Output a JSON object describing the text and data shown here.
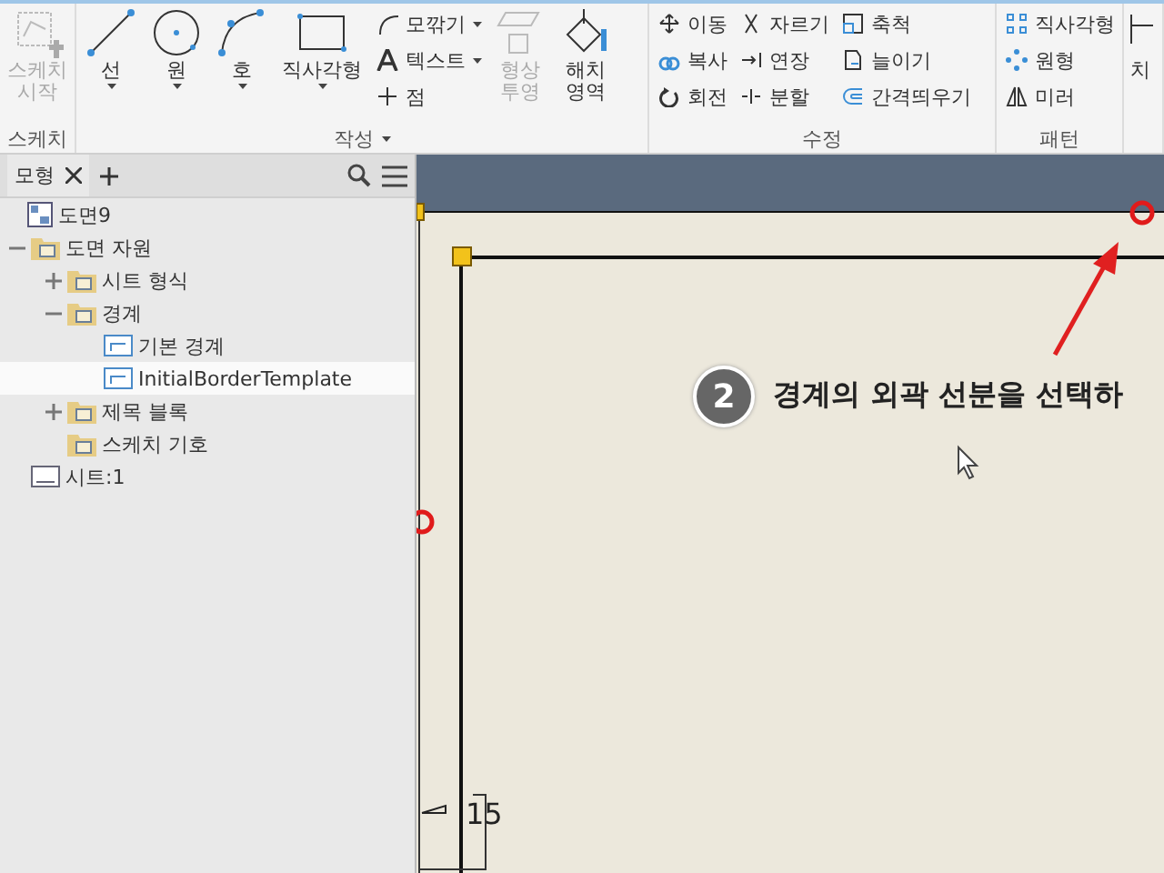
{
  "ribbon": {
    "groups": [
      {
        "title": "스케치",
        "title_dropdown": false,
        "tools": [
          {
            "kind": "large",
            "label": "스케치\n시작",
            "disabled": true,
            "dropdown": false
          }
        ]
      },
      {
        "title": "작성",
        "title_dropdown": true,
        "tools": [
          {
            "kind": "large",
            "label": "선",
            "disabled": false,
            "dropdown": true
          },
          {
            "kind": "large",
            "label": "원",
            "disabled": false,
            "dropdown": true
          },
          {
            "kind": "large",
            "label": "호",
            "disabled": false,
            "dropdown": true
          },
          {
            "kind": "large",
            "label": "직사각형",
            "disabled": false,
            "dropdown": true
          },
          {
            "kind": "column",
            "items": [
              {
                "label": "모깎기",
                "dropdown": true
              },
              {
                "label": "텍스트",
                "dropdown": true
              },
              {
                "label": "점",
                "dropdown": false
              }
            ]
          },
          {
            "kind": "large",
            "label": "형상\n투영",
            "disabled": true,
            "dropdown": false
          },
          {
            "kind": "large",
            "label": "해치\n영역",
            "disabled": false,
            "dropdown": false
          }
        ]
      },
      {
        "title": "수정",
        "title_dropdown": false,
        "tools": [
          {
            "kind": "column",
            "items": [
              {
                "label": "이동",
                "dropdown": false
              },
              {
                "label": "복사",
                "dropdown": false
              },
              {
                "label": "회전",
                "dropdown": false
              }
            ]
          },
          {
            "kind": "column",
            "items": [
              {
                "label": "자르기",
                "dropdown": false
              },
              {
                "label": "연장",
                "dropdown": false
              },
              {
                "label": "분할",
                "dropdown": false
              }
            ]
          },
          {
            "kind": "column",
            "items": [
              {
                "label": "축척",
                "dropdown": false
              },
              {
                "label": "늘이기",
                "dropdown": false
              },
              {
                "label": "간격띄우기",
                "dropdown": false
              }
            ]
          }
        ]
      },
      {
        "title": "패턴",
        "title_dropdown": false,
        "tools": [
          {
            "kind": "column",
            "items": [
              {
                "label": "직사각형",
                "dropdown": false
              },
              {
                "label": "원형",
                "dropdown": false
              },
              {
                "label": "미러",
                "dropdown": false
              }
            ]
          }
        ]
      },
      {
        "title_dropdown": false,
        "tools": [
          {
            "kind": "large",
            "label": "치",
            "disabled": false,
            "dropdown": false
          }
        ]
      }
    ]
  },
  "browser": {
    "tab": "모형",
    "tree": [
      {
        "label": "도면9",
        "kind": "drawing",
        "selected": false,
        "children": [
          {
            "label": "도면 자원",
            "kind": "folder",
            "expanded": true,
            "selected": false,
            "children": [
              {
                "label": "시트 형식",
                "kind": "folder",
                "expanded": false,
                "selected": false
              },
              {
                "label": "경계",
                "kind": "folder",
                "expanded": true,
                "selected": false,
                "children": [
                  {
                    "label": "기본 경계",
                    "kind": "border",
                    "selected": false
                  },
                  {
                    "label": "InitialBorderTemplate",
                    "kind": "border",
                    "selected": true
                  }
                ]
              },
              {
                "label": "제목 블록",
                "kind": "folder",
                "expanded": false,
                "selected": false
              },
              {
                "label": "스케치 기호",
                "kind": "folder",
                "selected": false
              }
            ]
          },
          {
            "label": "시트:1",
            "kind": "sheet",
            "selected": false
          }
        ]
      }
    ]
  },
  "canvas": {
    "callout": {
      "number": "2",
      "text": "경계의 외곽 선분을 선택하"
    },
    "dimension": "15"
  }
}
